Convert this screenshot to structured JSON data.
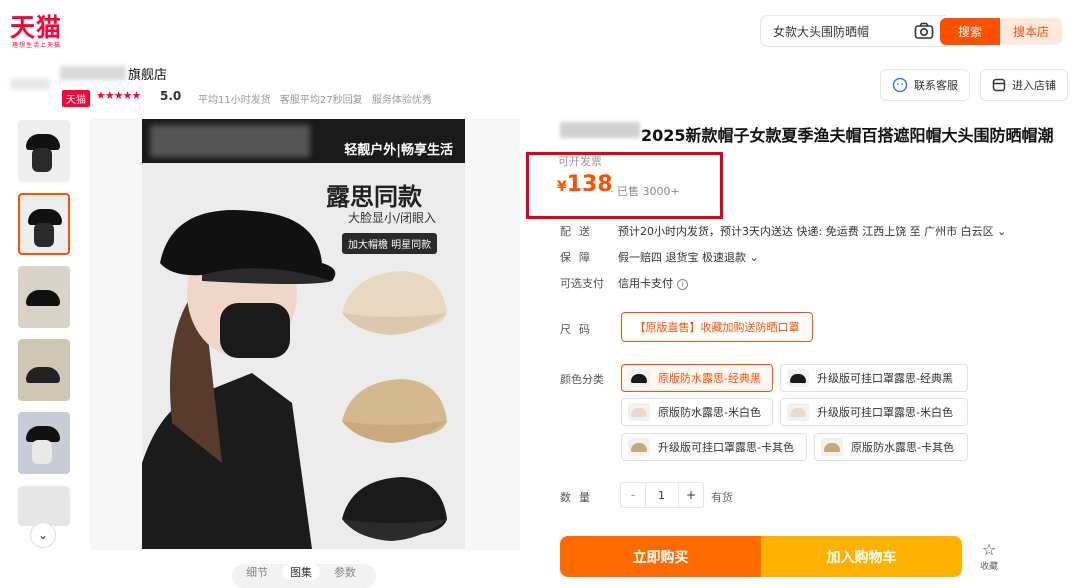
{
  "brand": {
    "logo": "天猫",
    "logo_sub": "理想生活上天猫"
  },
  "search": {
    "query": "女款大头围防晒帽",
    "search_label": "搜索",
    "store_search_label": "搜本店"
  },
  "shop": {
    "name": "旗舰店",
    "badge": "天猫",
    "stars": "★★★★★",
    "rating": "5.0",
    "meta": [
      "平均11小时发货",
      "客服平均27秒回复",
      "服务体验优秀"
    ],
    "contact_label": "联系客服",
    "enter_label": "进入店铺"
  },
  "thumbnails": [
    {
      "selected": false
    },
    {
      "selected": true
    },
    {
      "selected": false
    },
    {
      "selected": false
    },
    {
      "selected": false
    },
    {
      "selected": false
    }
  ],
  "main_image": {
    "banner_text": "轻靓户外|畅享生活",
    "title": "露思同款",
    "subtitle": "大脸显小/闭眼入",
    "tag": "加大帽檐 明星同款"
  },
  "product": {
    "title": "2025新款帽子女款夏季渔夫帽百搭遮阳帽大头围防晒帽潮",
    "price_label": "可开发票",
    "currency": "¥",
    "price": "138",
    "sold": "· 已售 3000+"
  },
  "rows": {
    "delivery_label": "配送",
    "delivery_value": "预计20小时内发货，预计3天内送达  快递: 免运费  江西上饶  至  广州市 白云区 ⌄",
    "guarantee_label": "保障",
    "guarantee_value": "假一赔四  退货宝  极速退款 ⌄",
    "payment_label": "可选支付",
    "payment_value": "信用卡支付",
    "payment_info": "i",
    "size_label": "尺码",
    "size_option": "【原版直售】收藏加购送防晒口罩",
    "color_label": "颜色分类",
    "qty_label": "数量"
  },
  "colors": [
    {
      "label": "原版防水露思-经典黑",
      "selected": true,
      "swatch": "#1a1a1a"
    },
    {
      "label": "升级版可挂口罩露思-经典黑",
      "selected": false,
      "swatch": "#1a1a1a"
    },
    {
      "label": "原版防水露思-米白色",
      "selected": false,
      "swatch": "#e8dcc8"
    },
    {
      "label": "升级版可挂口罩露思-米白色",
      "selected": false,
      "swatch": "#e8dcc8"
    },
    {
      "label": "升级版可挂口罩露思-卡其色",
      "selected": false,
      "swatch": "#c9a878"
    },
    {
      "label": "原版防水露思-卡其色",
      "selected": false,
      "swatch": "#c9a878"
    }
  ],
  "quantity": {
    "minus": "-",
    "value": "1",
    "plus": "+",
    "stock": "有货"
  },
  "actions": {
    "buy_now": "立即购买",
    "add_cart": "加入购物车",
    "favorite": "收藏"
  },
  "tabs": [
    "细节",
    "图集",
    "参数"
  ],
  "colors_theme": {
    "accent": "#ff5000",
    "tmall": "#ff0036",
    "cart": "#ffb100",
    "highlight_box": "#e3001b"
  }
}
